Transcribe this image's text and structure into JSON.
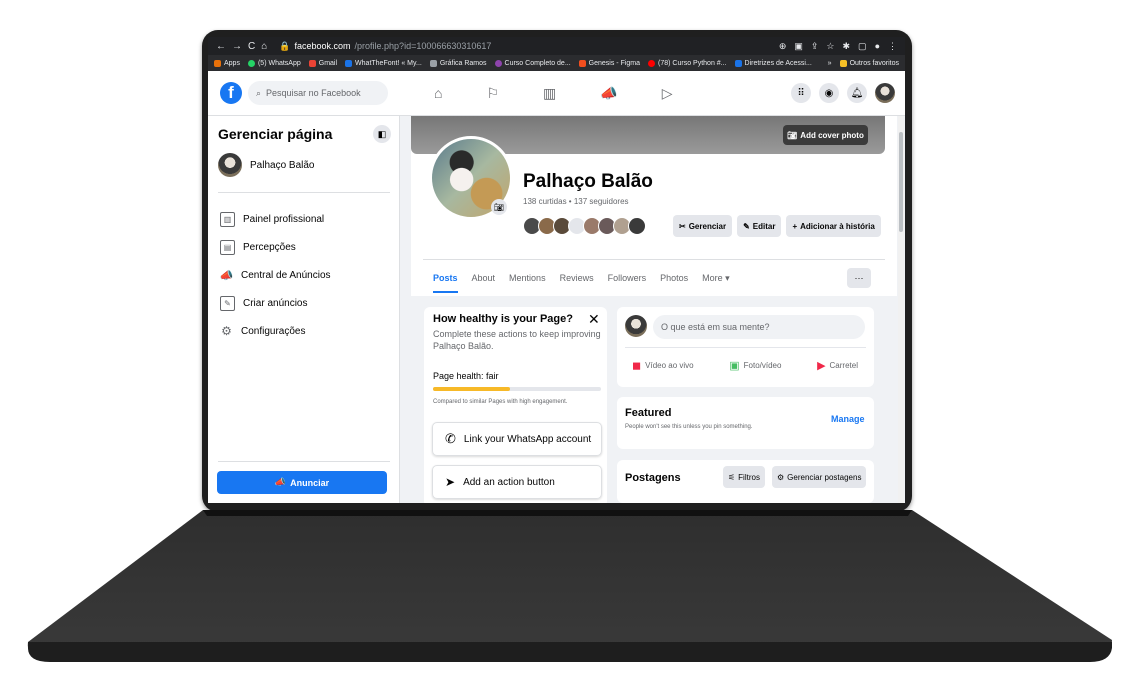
{
  "browser": {
    "url_host": "facebook.com",
    "url_path": "/profile.php?id=100066630310617",
    "bookmarks": [
      {
        "label": "Apps",
        "color": "#e8710a"
      },
      {
        "label": "(5) WhatsApp",
        "color": "#25d366"
      },
      {
        "label": "Gmail",
        "color": "#ea4335"
      },
      {
        "label": "WhatTheFont! « My...",
        "color": "#1a73e8"
      },
      {
        "label": "Gráfica Ramos",
        "color": "#9aa0a6"
      },
      {
        "label": "Curso Completo de...",
        "color": "#8e44ad"
      },
      {
        "label": "Genesis - Figma",
        "color": "#f24e1e"
      },
      {
        "label": "(78) Curso Python #...",
        "color": "#ff0000"
      },
      {
        "label": "Diretrizes de Acessi...",
        "color": "#1a73e8"
      }
    ],
    "bookmarks_more": "»",
    "bookmarks_other": "Outros favoritos"
  },
  "topbar": {
    "search_placeholder": "Pesquisar no Facebook"
  },
  "sidebar": {
    "title": "Gerenciar página",
    "page_name": "Palhaço Balão",
    "items": [
      {
        "label": "Painel profissional",
        "icon": "dashboard-icon"
      },
      {
        "label": "Percepções",
        "icon": "insights-icon"
      },
      {
        "label": "Central de Anúncios",
        "icon": "megaphone-icon"
      },
      {
        "label": "Criar anúncios",
        "icon": "pencil-icon"
      },
      {
        "label": "Configurações",
        "icon": "gear-icon"
      }
    ],
    "promote_label": "Anunciar"
  },
  "profile": {
    "add_cover": "Add cover photo",
    "name": "Palhaço Balão",
    "stats": "138 curtidas • 137 seguidores",
    "buttons": {
      "manage": "Gerenciar",
      "edit": "Editar",
      "add_story": "Adicionar à história"
    },
    "tabs": [
      "Posts",
      "About",
      "Mentions",
      "Reviews",
      "Followers",
      "Photos",
      "More ▾"
    ],
    "more_dots": "···"
  },
  "health": {
    "title": "How healthy is your Page?",
    "description": "Complete these actions to keep improving Palhaço Balão.",
    "label": "Page health: fair",
    "progress": 0.46,
    "comparison": "Compared to similar Pages with high engagement.",
    "actions": [
      "Link your WhatsApp account",
      "Add an action button"
    ]
  },
  "composer": {
    "placeholder": "O que está em sua mente?",
    "actions": [
      "Vídeo ao vivo",
      "Foto/vídeo",
      "Carretel"
    ]
  },
  "featured": {
    "title": "Featured",
    "subtitle": "People won't see this unless you pin something.",
    "manage": "Manage"
  },
  "posts": {
    "title": "Postagens",
    "filters": "Filtros",
    "manage": "Gerenciar postagens"
  },
  "colors": {
    "brand": "#1877f2",
    "health_bar": "#f7b928"
  }
}
